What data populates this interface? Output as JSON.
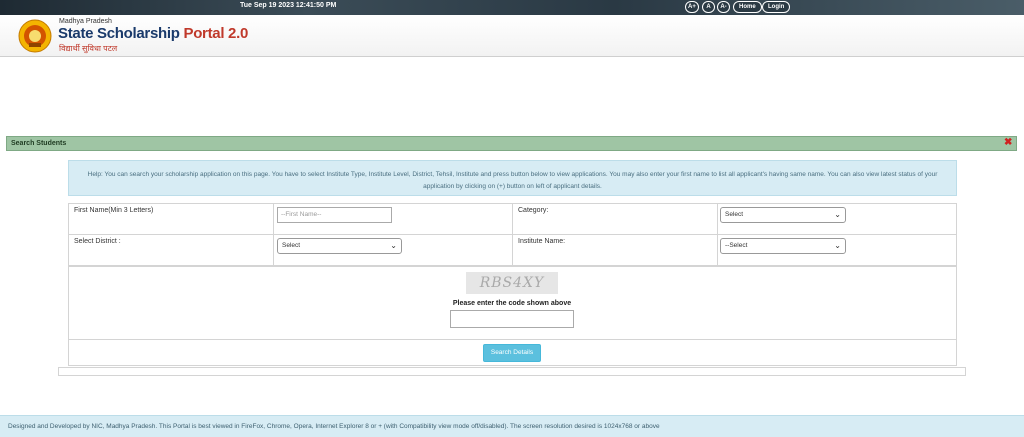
{
  "topbar": {
    "datetime": "Tue Sep 19 2023 12:41:50 PM",
    "font_increase": "A+",
    "font_normal": "A",
    "font_decrease": "A-",
    "home_label": "Home",
    "login_label": "Login"
  },
  "header": {
    "state": "Madhya Pradesh",
    "title": "State Scholarship",
    "title_accent": "Portal 2.0",
    "hindi_title": "विद्यार्थी सुविधा पटल"
  },
  "panel": {
    "title": "Search Students",
    "close_icon": "close-x-icon"
  },
  "help_text": "Help: You can search your scholarship application on this page. You have to select Institute Type, Institute Level, District, Tehsil, Institute and press button below to view applications. You may also enter your first name to list all applicant's having same name. You can also view latest status of your application by clicking on (+) button on left of applicant details.",
  "form": {
    "first_name_label": "First Name(Min 3 Letters)",
    "first_name_placeholder": "--First Name--",
    "category_label": "Category:",
    "category_selected": "Select",
    "district_label": "Select District :",
    "district_selected": "Select",
    "institute_label": "Institute Name:",
    "institute_selected": "--Select"
  },
  "captcha": {
    "code": "RBS4XY",
    "hint": "Please enter the code shown above",
    "value": ""
  },
  "search_button": "Search Details",
  "footer": "Designed and Developed by NIC, Madhya Pradesh. This Portal is best viewed in FireFox, Chrome, Opera, Internet Explorer 8 or + (with Compatibility view mode off/disabled). The screen resolution desired is 1024x768 or above",
  "colors": {
    "panel_header": "#9fc5a4",
    "help_bg": "#d7ecf4",
    "button": "#5bc0de",
    "brand_blue": "#1a3a6b",
    "brand_red": "#c0392b"
  }
}
